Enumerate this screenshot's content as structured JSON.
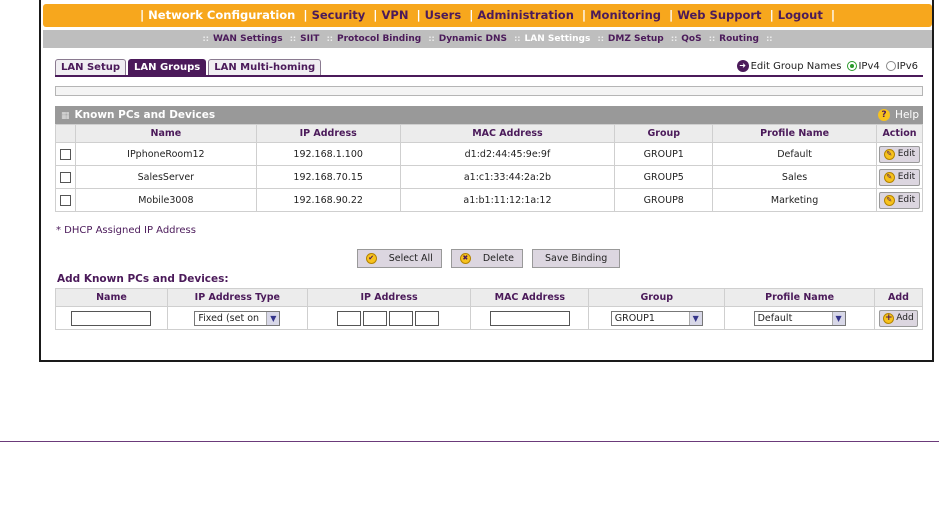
{
  "top_nav": {
    "items": [
      "Network Configuration",
      "Security",
      "VPN",
      "Users",
      "Administration",
      "Monitoring",
      "Web Support",
      "Logout"
    ],
    "active_index": 0
  },
  "sub_nav": {
    "items": [
      "WAN Settings",
      "SIIT",
      "Protocol Binding",
      "Dynamic DNS",
      "LAN Settings",
      "DMZ Setup",
      "QoS",
      "Routing"
    ],
    "active_index": 4
  },
  "tabs": {
    "items": [
      "LAN Setup",
      "LAN Groups",
      "LAN Multi-homing"
    ],
    "active_index": 1
  },
  "options": {
    "edit_group_names": "Edit Group Names",
    "ipv4": "IPv4",
    "ipv6": "IPv6",
    "selected": "IPv4"
  },
  "known": {
    "title": "Known PCs and Devices",
    "help": "Help",
    "columns": [
      "Name",
      "IP Address",
      "MAC Address",
      "Group",
      "Profile Name",
      "Action"
    ],
    "rows": [
      {
        "name": "IPphoneRoom12",
        "ip": "192.168.1.100",
        "mac": "d1:d2:44:45:9e:9f",
        "group": "GROUP1",
        "profile": "Default",
        "action": "Edit"
      },
      {
        "name": "SalesServer",
        "ip": "192.168.70.15",
        "mac": "a1:c1:33:44:2a:2b",
        "group": "GROUP5",
        "profile": "Sales",
        "action": "Edit"
      },
      {
        "name": "Mobile3008",
        "ip": "192.168.90.22",
        "mac": "a1:b1:11:12:1a:12",
        "group": "GROUP8",
        "profile": "Marketing",
        "action": "Edit"
      }
    ],
    "note": "* DHCP Assigned IP Address"
  },
  "buttons": {
    "select_all": "Select All",
    "delete": "Delete",
    "save_binding": "Save Binding"
  },
  "add": {
    "title": "Add Known PCs and Devices:",
    "columns": [
      "Name",
      "IP Address Type",
      "IP Address",
      "MAC Address",
      "Group",
      "Profile Name",
      "Add"
    ],
    "ip_type_value": "Fixed (set on",
    "group_value": "GROUP1",
    "profile_value": "Default",
    "add_label": "Add"
  },
  "colors": {
    "accent": "#f7a71d",
    "brand": "#4b1a5a",
    "header_gray": "#999999"
  }
}
